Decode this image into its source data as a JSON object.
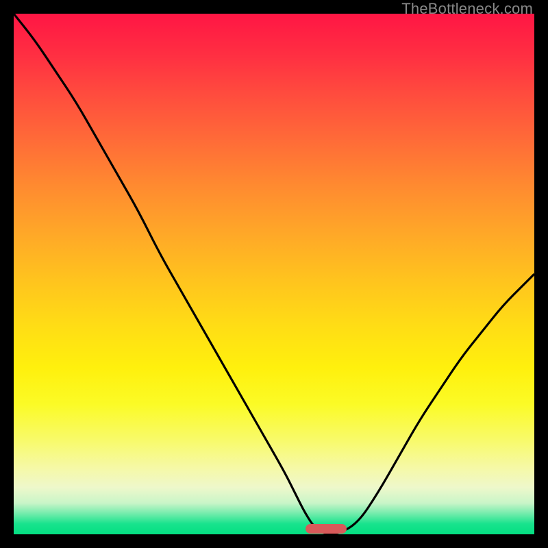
{
  "watermark": "TheBottleneck.com",
  "colors": {
    "page_bg": "#000000",
    "curve_stroke": "#000000",
    "marker_fill": "#d85a5a",
    "watermark_text": "#888888"
  },
  "chart_data": {
    "type": "line",
    "title": "",
    "xlabel": "",
    "ylabel": "",
    "xlim": [
      0,
      100
    ],
    "ylim": [
      0,
      100
    ],
    "grid": false,
    "series": [
      {
        "name": "bottleneck-curve",
        "x": [
          0,
          4,
          8,
          12,
          16,
          20,
          24,
          28,
          32,
          36,
          40,
          44,
          48,
          52,
          54,
          56,
          58,
          60,
          62,
          66,
          70,
          74,
          78,
          82,
          86,
          90,
          94,
          98,
          100
        ],
        "y": [
          100,
          95,
          89,
          83,
          76,
          69,
          62,
          54,
          47,
          40,
          33,
          26,
          19,
          12,
          8,
          4,
          1,
          0,
          0,
          2,
          8,
          15,
          22,
          28,
          34,
          39,
          44,
          48,
          50
        ]
      }
    ],
    "marker": {
      "x_center": 60,
      "width_pct": 8,
      "y": 0
    }
  }
}
